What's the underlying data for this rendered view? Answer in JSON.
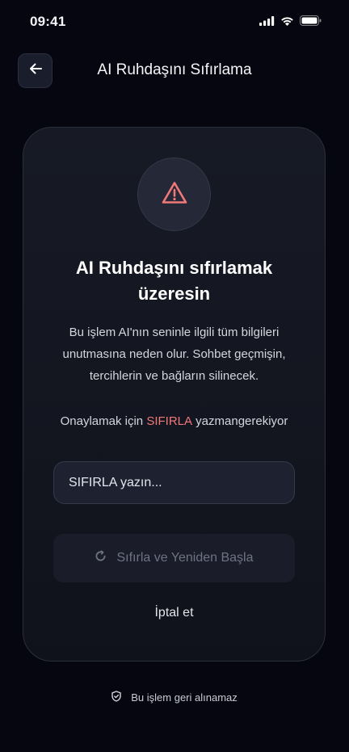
{
  "status_bar": {
    "time": "09:41",
    "icons": [
      "signal-icon",
      "wifi-icon",
      "battery-icon"
    ]
  },
  "header": {
    "back_icon": "arrow-left-icon",
    "title": "AI Ruhdaşını Sıfırlama"
  },
  "card": {
    "warning_icon": "warning-triangle-icon",
    "heading": "AI Ruhdaşını sıfırlamak üzeresin",
    "description": "Bu işlem AI'nın seninle ilgili tüm bilgileri unutmasına neden olur. Sohbet geçmişin, tercihlerin ve bağların silinecek.",
    "confirm_prefix": "Onaylamak için ",
    "confirm_keyword": "SIFIRLA",
    "confirm_suffix": " yazmangerekiyor",
    "input_value": "",
    "input_placeholder": "SIFIRLA yazın...",
    "reset_button_label": "Sıfırla ve Yeniden Başla",
    "reset_button_icon": "refresh-icon",
    "reset_button_enabled": false,
    "cancel_label": "İptal et"
  },
  "footer": {
    "icon": "shield-check-icon",
    "note": "Bu işlem geri alınamaz"
  },
  "colors": {
    "background": "#05060f",
    "card": "#141722",
    "accent_warning": "#f07878",
    "input_background": "#1e2130",
    "disabled_button": "#1a1d29"
  }
}
